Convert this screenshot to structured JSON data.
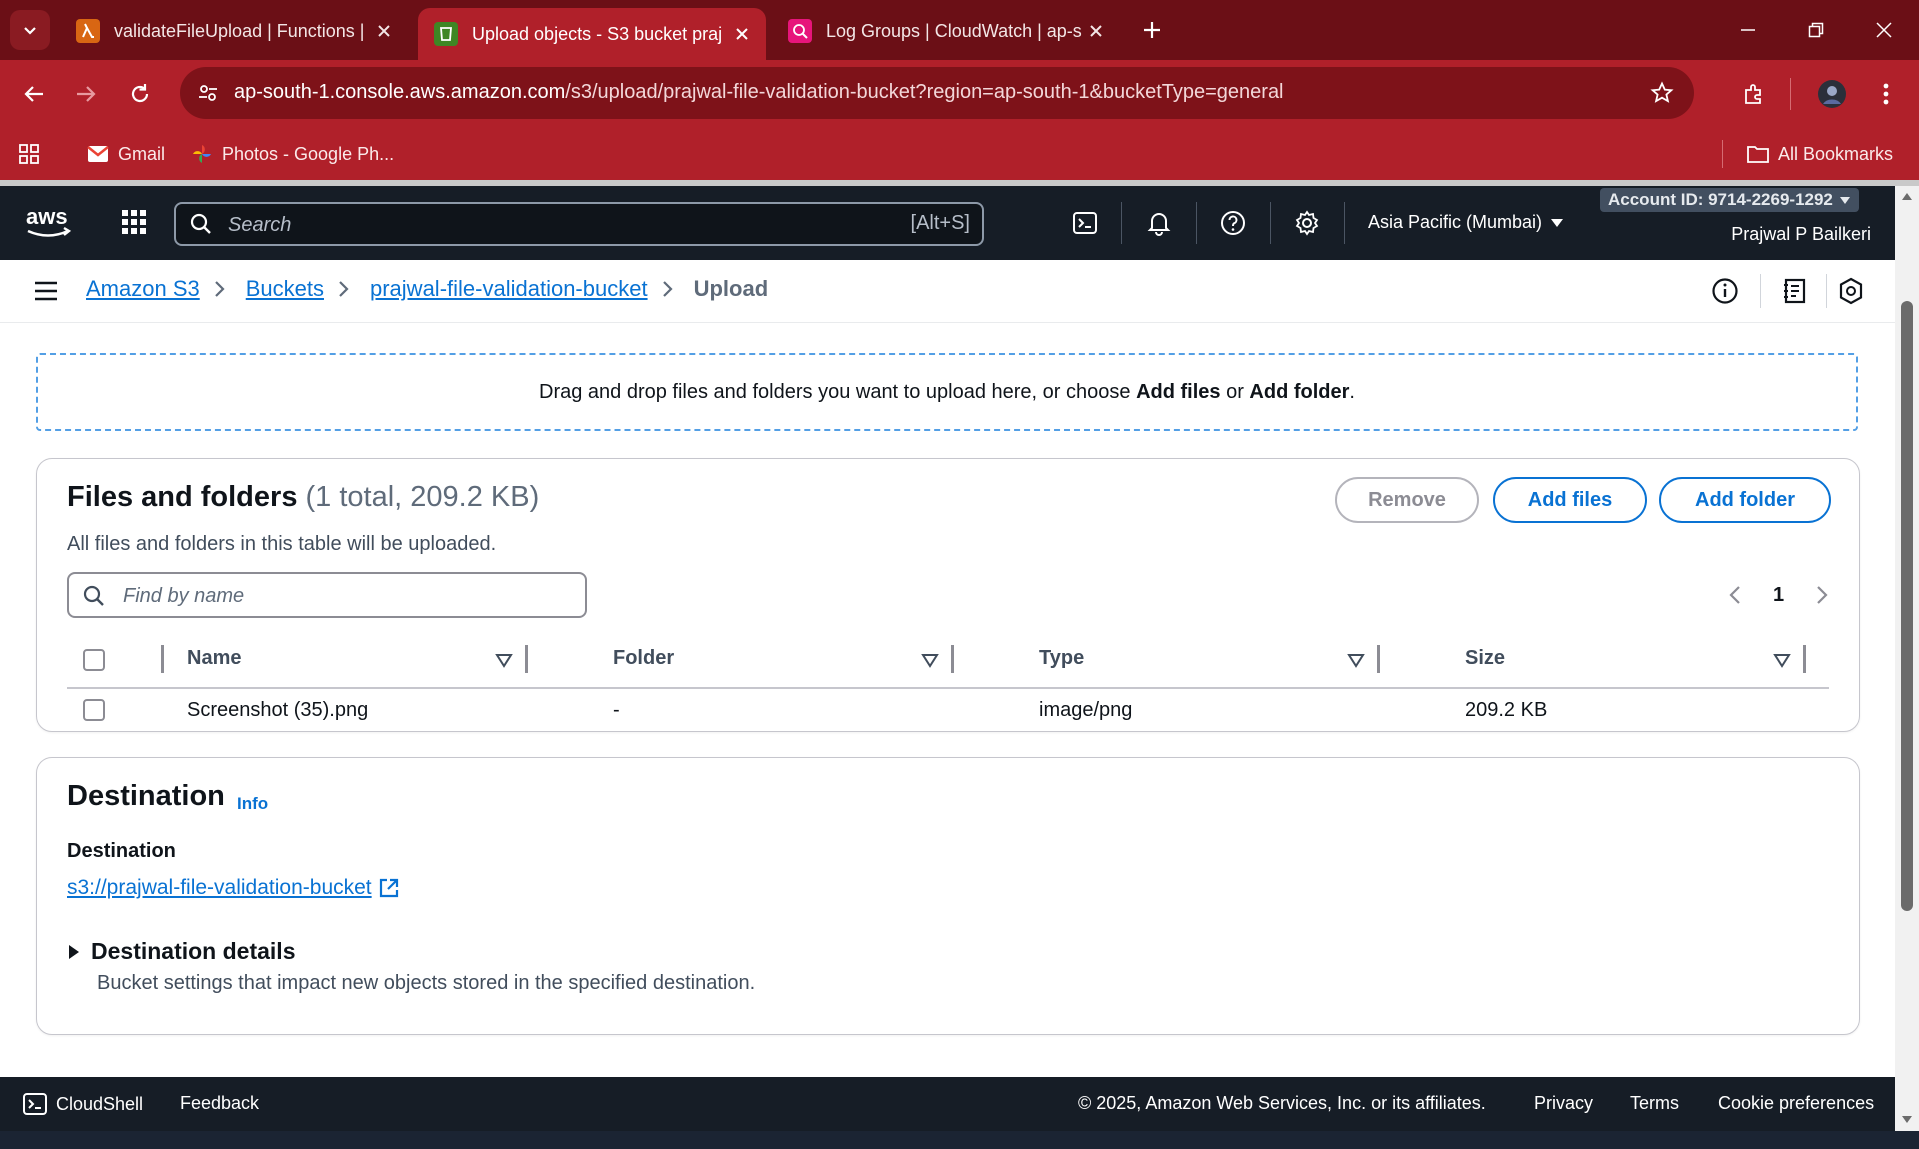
{
  "browser": {
    "tabs": [
      {
        "title": "validateFileUpload | Functions |",
        "active": false
      },
      {
        "title": "Upload objects - S3 bucket praj",
        "active": true
      },
      {
        "title": "Log Groups | CloudWatch | ap-s",
        "active": false
      }
    ],
    "url_host": "ap-south-1.console.aws.amazon.com",
    "url_path": "/s3/upload/prajwal-file-validation-bucket?region=ap-south-1&bucketType=general",
    "bookmarks": [
      {
        "label": "Gmail"
      },
      {
        "label": "Photos - Google Ph..."
      }
    ],
    "all_bookmarks": "All Bookmarks"
  },
  "aws_header": {
    "logo": "aws",
    "search_placeholder": "Search",
    "search_shortcut": "[Alt+S]",
    "region": "Asia Pacific (Mumbai)",
    "account": "Account ID: 9714-2269-1292",
    "user": "Prajwal P Bailkeri"
  },
  "breadcrumb": {
    "items": [
      "Amazon S3",
      "Buckets",
      "prajwal-file-validation-bucket"
    ],
    "current": "Upload"
  },
  "dropzone": {
    "text_start": "Drag and drop files and folders you want to upload here, or choose ",
    "add_files": "Add files",
    "or": " or ",
    "add_folder": "Add folder",
    "end": "."
  },
  "files_panel": {
    "title": "Files and folders",
    "count": "(1 total, 209.2 KB)",
    "description": "All files and folders in this table will be uploaded.",
    "remove_label": "Remove",
    "add_files_label": "Add files",
    "add_folder_label": "Add folder",
    "find_placeholder": "Find by name",
    "page": "1",
    "columns": [
      "Name",
      "Folder",
      "Type",
      "Size"
    ],
    "rows": [
      {
        "name": "Screenshot (35).png",
        "folder": "-",
        "type": "image/png",
        "size": "209.2 KB"
      }
    ]
  },
  "destination_panel": {
    "title": "Destination",
    "info": "Info",
    "label": "Destination",
    "link": "s3://prajwal-file-validation-bucket",
    "details_title": "Destination details",
    "details_desc": "Bucket settings that impact new objects stored in the specified destination."
  },
  "footer": {
    "cloudshell": "CloudShell",
    "feedback": "Feedback",
    "copyright": "© 2025, Amazon Web Services, Inc. or its affiliates.",
    "privacy": "Privacy",
    "terms": "Terms",
    "cookie": "Cookie preferences"
  },
  "colors": {
    "chrome_tabbar": "#6b0f16",
    "chrome_toolbar": "#b0202a",
    "aws_header": "#161d26",
    "link_blue": "#0972d3"
  }
}
